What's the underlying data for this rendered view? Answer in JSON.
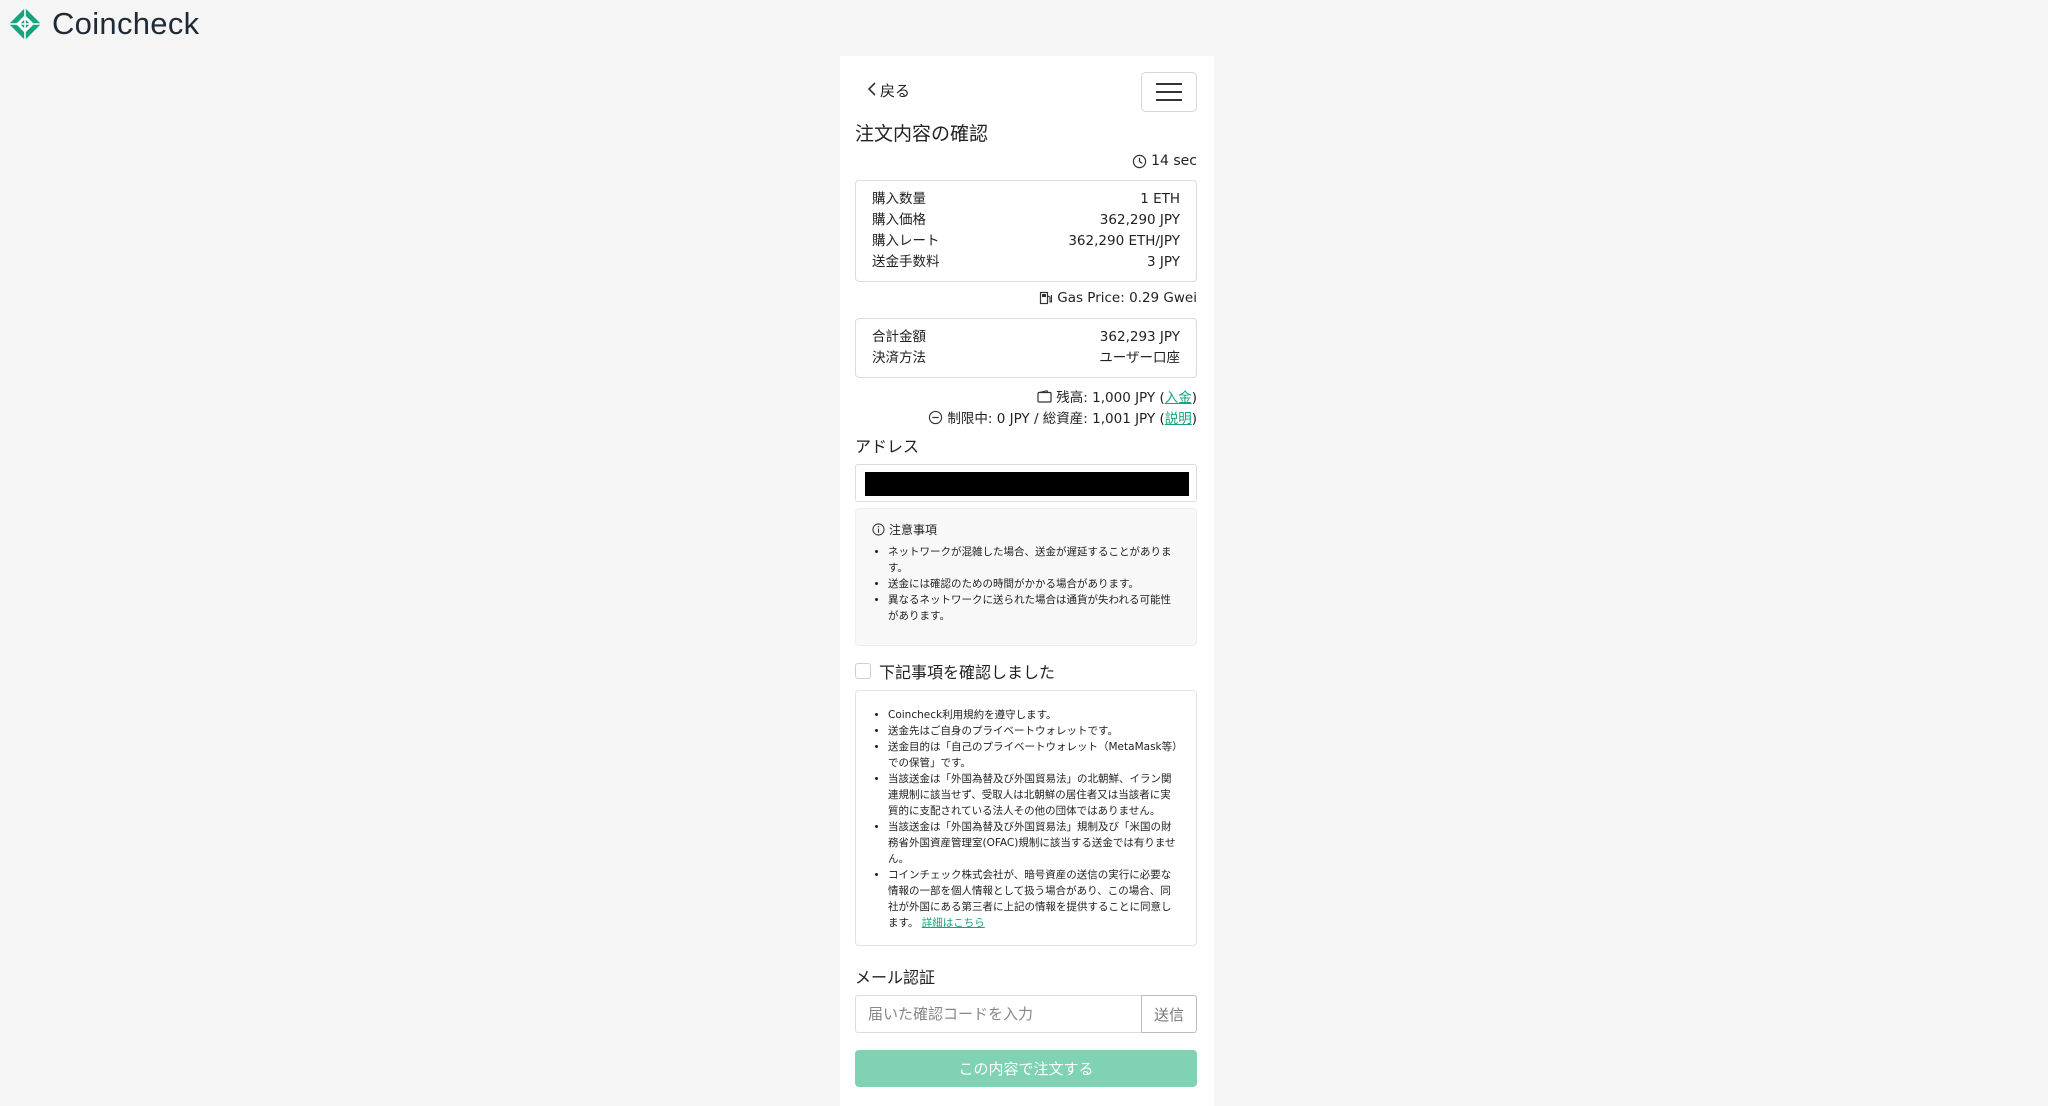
{
  "header": {
    "logo_text": "Coincheck",
    "brand_color": "#16a37d"
  },
  "nav": {
    "back_label": "戻る",
    "menu_icon": "hamburger-icon"
  },
  "page": {
    "title": "注文内容の確認",
    "timer": "14 sec"
  },
  "order_details": [
    {
      "label": "購入数量",
      "value": "1 ETH"
    },
    {
      "label": "購入価格",
      "value": "362,290 JPY"
    },
    {
      "label": "購入レート",
      "value": "362,290 ETH/JPY"
    },
    {
      "label": "送金手数料",
      "value": "3 JPY"
    }
  ],
  "gas": {
    "text": "Gas Price: 0.29 Gwei"
  },
  "summary": [
    {
      "label": "合計金額",
      "value": "362,293 JPY"
    },
    {
      "label": "決済方法",
      "value": "ユーザー口座"
    }
  ],
  "balance": {
    "prefix": "残高: 1,000 JPY (",
    "link": "入金",
    "suffix": ")"
  },
  "limit": {
    "prefix": "制限中: 0 JPY / 総資産: 1,001 JPY (",
    "link": "説明",
    "suffix": ")"
  },
  "address": {
    "label": "アドレス"
  },
  "notice": {
    "title": "注意事項",
    "items": [
      "ネットワークが混雑した場合、送金が遅延することがあります。",
      "送金には確認のための時間がかかる場合があります。",
      "異なるネットワークに送られた場合は通貨が失われる可能性があります。"
    ]
  },
  "confirm": {
    "label": "下記事項を確認しました"
  },
  "terms": {
    "items": [
      "Coincheck利用規約を遵守します。",
      "送金先はご自身のプライベートウォレットです。",
      "送金目的は「自己のプライベートウォレット（MetaMask等）での保管」です。",
      "当該送金は「外国為替及び外国貿易法」の北朝鮮、イラン関連規制に該当せず、受取人は北朝鮮の居住者又は当該者に実質的に支配されている法人その他の団体ではありません。",
      "当該送金は「外国為替及び外国貿易法」規制及び「米国の財務省外国資産管理室(OFAC)規制に該当する送金では有りません。",
      "コインチェック株式会社が、暗号資産の送信の実行に必要な情報の一部を個人情報として扱う場合があり、この場合、同社が外国にある第三者に上記の情報を提供することに同意します。"
    ],
    "detail_link": "詳細はこちら"
  },
  "mail": {
    "label": "メール認証",
    "placeholder": "届いた確認コードを入力",
    "send_label": "送信"
  },
  "submit": {
    "label": "この内容で注文する"
  }
}
